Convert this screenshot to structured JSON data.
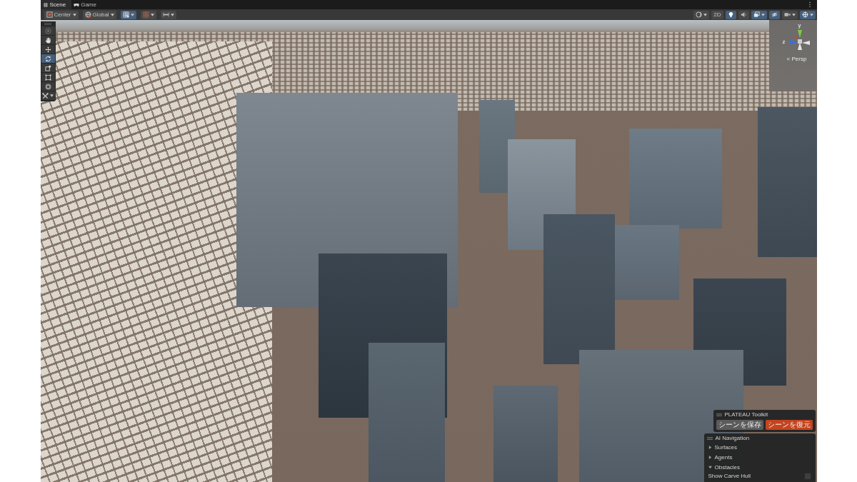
{
  "tabs": [
    {
      "kind": "scene",
      "label": "Scene",
      "selected": true
    },
    {
      "kind": "game",
      "label": "Game",
      "selected": false
    }
  ],
  "tab_menu": "⋮",
  "toolbar": {
    "left": [
      {
        "kind": "pivot",
        "label": "Center",
        "menu": true,
        "selected": false
      },
      {
        "kind": "space",
        "label": "Global",
        "menu": true,
        "selected": false
      },
      {
        "kind": "grid_snap",
        "menu": true,
        "selected": true
      },
      {
        "kind": "grid",
        "menu": true,
        "selected": false
      },
      {
        "kind": "increment",
        "menu": true,
        "selected": false
      }
    ],
    "right": [
      {
        "kind": "shading",
        "menu": true,
        "selected": false
      },
      {
        "kind": "mode2d",
        "label": "2D",
        "menu": false,
        "selected": false
      },
      {
        "kind": "lighting",
        "menu": false,
        "selected": true
      },
      {
        "kind": "audio",
        "menu": false,
        "selected": false
      },
      {
        "kind": "effects",
        "menu": true,
        "selected": true
      },
      {
        "kind": "visibility",
        "menu": false,
        "selected": true
      },
      {
        "kind": "camera",
        "menu": true,
        "selected": false
      },
      {
        "kind": "gizmos",
        "menu": true,
        "selected": true
      }
    ]
  },
  "tool_palette": {
    "tools": [
      {
        "kind": "view",
        "selected": false,
        "disabled": true,
        "menu": false
      },
      {
        "kind": "hand",
        "selected": false,
        "disabled": false,
        "menu": false
      },
      {
        "kind": "move",
        "selected": false,
        "disabled": false,
        "menu": false
      },
      {
        "kind": "rotate",
        "selected": true,
        "disabled": false,
        "menu": false
      },
      {
        "kind": "scale",
        "selected": false,
        "disabled": false,
        "menu": false
      },
      {
        "kind": "rect",
        "selected": false,
        "disabled": false,
        "menu": false
      },
      {
        "kind": "transform",
        "selected": false,
        "disabled": false,
        "menu": false
      },
      {
        "kind": "custom",
        "selected": false,
        "disabled": false,
        "menu": true
      }
    ]
  },
  "view_gizmo": {
    "axes": [
      {
        "kind": "y",
        "label": "y"
      },
      {
        "kind": "z",
        "label": "z"
      }
    ],
    "projection": "< Persp"
  },
  "overlays": [
    {
      "kind": "buttons",
      "title": "PLATEAU Toolkit",
      "buttons": [
        {
          "kind": "secondary",
          "label": "シーンを保存"
        },
        {
          "kind": "primary",
          "label": "シーンを復元"
        }
      ]
    },
    {
      "kind": "foldouts",
      "title": "AI Navigation",
      "sections": [
        {
          "label": "Surfaces",
          "expanded": false
        },
        {
          "label": "Agents",
          "expanded": false
        },
        {
          "label": "Obstacles",
          "expanded": true,
          "children": [
            {
              "label": "Show Carve Hull",
              "checked": false
            }
          ]
        }
      ]
    }
  ]
}
